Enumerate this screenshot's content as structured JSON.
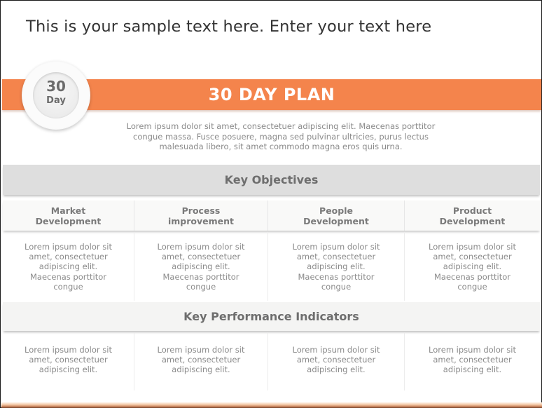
{
  "page": {
    "heading": "This is your sample text here. Enter your text here"
  },
  "banner": {
    "title": "30 DAY PLAN",
    "accent_color": "#F4844C",
    "badge": {
      "number": "30",
      "unit": "Day"
    }
  },
  "description": "Lorem ipsum dolor sit amet, consectetuer adipiscing elit. Maecenas porttitor congue massa. Fusce posuere, magna sed pulvinar ultricies, purus lectus malesuada libero, sit amet commodo magna eros quis urna.",
  "description_lines": [
    "Lorem ipsum dolor sit amet, consectetuer adipiscing elit. Maecenas porttitor",
    "congue massa. Fusce posuere, magna sed pulvinar ultricies, purus lectus",
    "malesuada libero, sit amet commodo magna eros quis urna."
  ],
  "objectives": {
    "title": "Key Objectives",
    "columns": [
      {
        "header": "Market\nDevelopment",
        "text": "Lorem ipsum dolor sit\namet, consectetuer\nadipiscing elit.\nMaecenas porttitor\ncongue"
      },
      {
        "header": "Process\nimprovement",
        "text": "Lorem ipsum dolor sit\namet, consectetuer\nadipiscing elit.\nMaecenas porttitor\ncongue"
      },
      {
        "header": "People\nDevelopment",
        "text": "Lorem ipsum dolor sit\namet, consectetuer\nadipiscing elit.\nMaecenas porttitor\ncongue"
      },
      {
        "header": "Product\nDevelopment",
        "text": "Lorem ipsum dolor sit\namet, consectetuer\nadipiscing elit.\nMaecenas porttitor\ncongue"
      }
    ]
  },
  "kpi": {
    "title": "Key Performance Indicators",
    "cells": [
      "Lorem ipsum dolor sit\namet, consectetuer\nadipiscing elit.",
      "Lorem ipsum dolor sit\namet, consectetuer\nadipiscing elit.",
      "Lorem ipsum dolor sit\namet, consectetuer\nadipiscing elit.",
      "Lorem ipsum dolor sit\namet, consectetuer\nadipiscing elit."
    ]
  }
}
